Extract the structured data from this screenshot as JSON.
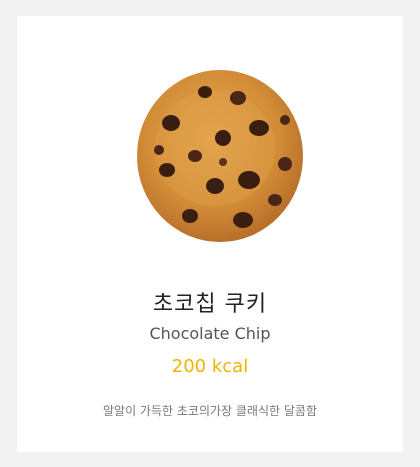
{
  "product": {
    "image_icon": "chocolate-chip-cookie-image",
    "name_ko": "초코칩 쿠키",
    "name_en": "Chocolate Chip",
    "calories": "200 kcal",
    "description": "알알이 가득한 초코의가장 클래식한 달콤함"
  },
  "colors": {
    "calories": "#f0b400",
    "cookie_base": "#d9963f",
    "chip": "#3b1e12"
  }
}
